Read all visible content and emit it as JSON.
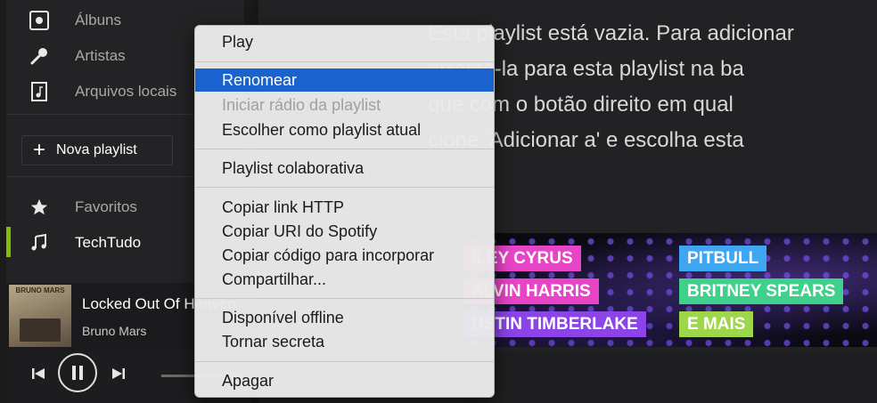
{
  "sidebar": {
    "items": [
      {
        "label": "Álbuns",
        "icon": "album-icon"
      },
      {
        "label": "Artistas",
        "icon": "microphone-icon"
      },
      {
        "label": "Arquivos locais",
        "icon": "local-file-icon"
      }
    ],
    "new_playlist_label": "Nova playlist",
    "playlists": [
      {
        "label": "Favoritos",
        "icon": "star-icon"
      },
      {
        "label": "TechTudo",
        "icon": "music-note-icon",
        "active": true
      }
    ]
  },
  "now_playing": {
    "title": "Locked Out Of Heaven",
    "artist": "Bruno Mars",
    "album_art_text": "BRUNO MARS"
  },
  "main": {
    "empty_message_lines": [
      "Esta playlist está vazia. Para adicionar",
      "arrastá-la para esta playlist na ba",
      "que com o botão direito em qual",
      "cione 'Adicionar a' e escolha esta"
    ],
    "banner_tags": [
      {
        "text": "ILEY CYRUS",
        "color": "#e844c6"
      },
      {
        "text": "PITBULL",
        "color": "#3fa6f2"
      },
      {
        "text": "ALVIN HARRIS",
        "color": "#e844c6"
      },
      {
        "text": "BRITNEY SPEARS",
        "color": "#3fd08c"
      },
      {
        "text": "USTIN TIMBERLAKE",
        "color": "#8c43e8"
      },
      {
        "text": "E MAIS",
        "color": "#9ed64a"
      }
    ]
  },
  "context_menu": {
    "items": [
      {
        "label": "Play"
      },
      {
        "label": "Renomear",
        "highlighted": true
      },
      {
        "label": "Iniciar rádio da playlist",
        "disabled": true
      },
      {
        "label": "Escolher como playlist atual"
      },
      {
        "label": "Playlist colaborativa"
      },
      {
        "label": "Copiar link HTTP"
      },
      {
        "label": "Copiar URI do Spotify"
      },
      {
        "label": "Copiar código para incorporar"
      },
      {
        "label": "Compartilhar..."
      },
      {
        "label": "Disponível offline"
      },
      {
        "label": "Tornar secreta"
      },
      {
        "label": "Apagar"
      }
    ]
  },
  "colors": {
    "accent": "#84bd00",
    "highlight": "#1a63cf"
  }
}
